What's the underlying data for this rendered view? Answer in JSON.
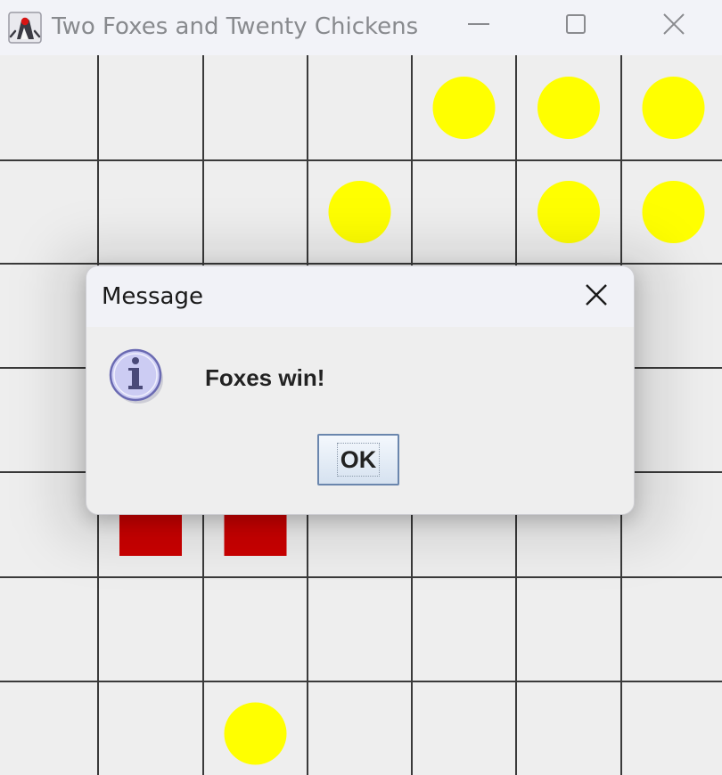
{
  "window": {
    "title": "Two Foxes and Twenty Chickens",
    "icon": "java-duke-icon",
    "controls": [
      "minimize-icon",
      "maximize-icon",
      "close-icon"
    ]
  },
  "board": {
    "visible_rows": 7,
    "visible_cols": 7,
    "chickens": [
      {
        "row": 0,
        "col": 4
      },
      {
        "row": 0,
        "col": 5
      },
      {
        "row": 0,
        "col": 6
      },
      {
        "row": 1,
        "col": 3
      },
      {
        "row": 1,
        "col": 5
      },
      {
        "row": 1,
        "col": 6
      },
      {
        "row": 6,
        "col": 2
      }
    ],
    "foxes": [
      {
        "row": 4,
        "col": 1
      },
      {
        "row": 4,
        "col": 2
      }
    ],
    "colors": {
      "background": "#eeeeee",
      "grid_line": "#3a3a3a",
      "chicken": "#ffff00",
      "fox": "#cc0000"
    }
  },
  "dialog": {
    "title": "Message",
    "message": "Foxes win!",
    "icon": "info-icon",
    "ok_label": "OK",
    "colors": {
      "icon_fill": "#ccccf3",
      "icon_stroke": "#6a6ab2"
    }
  }
}
